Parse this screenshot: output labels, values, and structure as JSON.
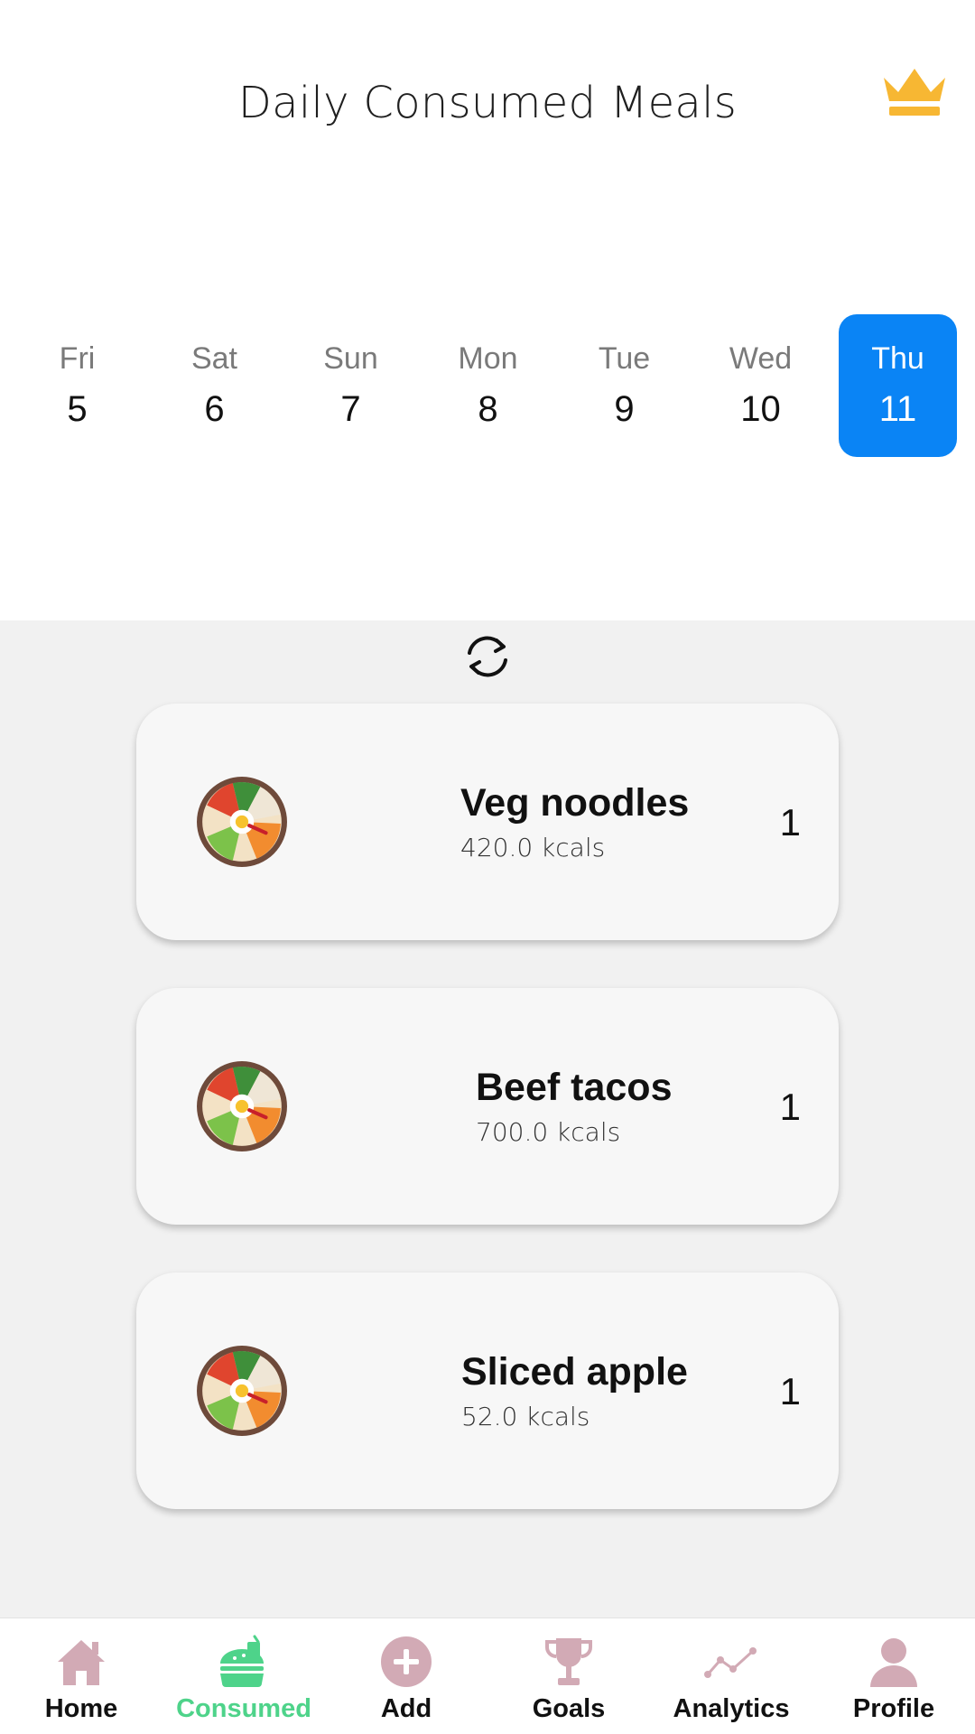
{
  "header": {
    "title": "Daily Consumed Meals",
    "premium_icon": "crown-icon"
  },
  "week": [
    {
      "day": "Fri",
      "date": "5"
    },
    {
      "day": "Sat",
      "date": "6"
    },
    {
      "day": "Sun",
      "date": "7"
    },
    {
      "day": "Mon",
      "date": "8"
    },
    {
      "day": "Tue",
      "date": "9"
    },
    {
      "day": "Wed",
      "date": "10"
    },
    {
      "day": "Thu",
      "date": "11",
      "selected": true
    }
  ],
  "refresh_icon": "refresh-icon",
  "meals": [
    {
      "name": "Veg noodles",
      "kcals": "420.0 kcals",
      "quantity": "1",
      "icon": "food-bowl-icon"
    },
    {
      "name": "Beef tacos",
      "kcals": "700.0 kcals",
      "quantity": "1",
      "icon": "food-bowl-icon"
    },
    {
      "name": "Sliced apple",
      "kcals": "52.0 kcals",
      "quantity": "1",
      "icon": "food-bowl-icon"
    }
  ],
  "nav": [
    {
      "label": "Home",
      "icon": "home-icon"
    },
    {
      "label": "Consumed",
      "icon": "consumed-icon",
      "active": true
    },
    {
      "label": "Add",
      "icon": "add-icon"
    },
    {
      "label": "Goals",
      "icon": "trophy-icon"
    },
    {
      "label": "Analytics",
      "icon": "analytics-icon"
    },
    {
      "label": "Profile",
      "icon": "profile-icon"
    }
  ],
  "colors": {
    "selected_day": "#0a84f5",
    "nav_active": "#4ed38a",
    "nav_icon": "#d2aab5",
    "crown": "#f7b733"
  }
}
